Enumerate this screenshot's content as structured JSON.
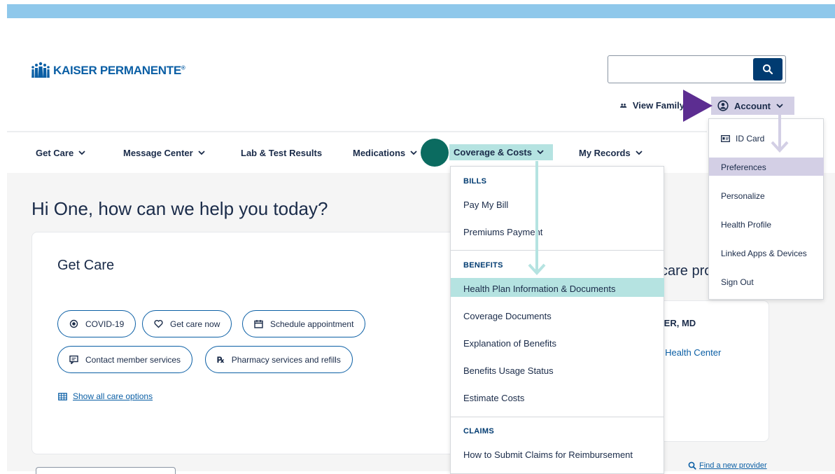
{
  "header": {
    "logo_text": "KAISER PERMANENTE",
    "logo_reg": "®",
    "search_placeholder": "",
    "view_family_label": "View Family",
    "account_label": "Account"
  },
  "nav": {
    "items": [
      {
        "label": "Get Care"
      },
      {
        "label": "Message Center"
      },
      {
        "label": "Lab & Test Results"
      },
      {
        "label": "Medications"
      },
      {
        "label": "Coverage & Costs"
      },
      {
        "label": "My Records"
      }
    ]
  },
  "main": {
    "greeting": "Hi One, how can we help you today?",
    "get_care_title": "Get Care",
    "pills": [
      {
        "label": "COVID-19"
      },
      {
        "label": "Get care now"
      },
      {
        "label": "Schedule appointment"
      },
      {
        "label": "Contact member services"
      },
      {
        "label": "Pharmacy services and refills"
      }
    ],
    "show_all": "Show all care options",
    "care_provider_partial": "care pro",
    "doctor_partial": "YER, MD",
    "health_center_partial": "y Health Center",
    "find_provider": "Find a new provider"
  },
  "coverage_menu": {
    "bills_heading": "BILLS",
    "bills_items": [
      "Pay My Bill",
      "Premiums Payment"
    ],
    "benefits_heading": "BENEFITS",
    "benefits_items": [
      "Health Plan Information & Documents",
      "Coverage Documents",
      "Explanation of Benefits",
      "Benefits Usage Status",
      "Estimate Costs"
    ],
    "claims_heading": "CLAIMS",
    "claims_items": [
      "How to Submit Claims for Reimbursement"
    ]
  },
  "account_menu": {
    "items": [
      "ID Card",
      "Preferences",
      "Personalize",
      "Health Profile",
      "Linked Apps & Devices",
      "Sign Out"
    ]
  },
  "colors": {
    "brand_blue": "#0b5fa5",
    "navy": "#003b71",
    "teal_highlight": "#b5e3e1",
    "purple_highlight": "#d3cfe5",
    "purple_arrow": "#5c2d91",
    "teal_dot": "#0b6b60"
  }
}
